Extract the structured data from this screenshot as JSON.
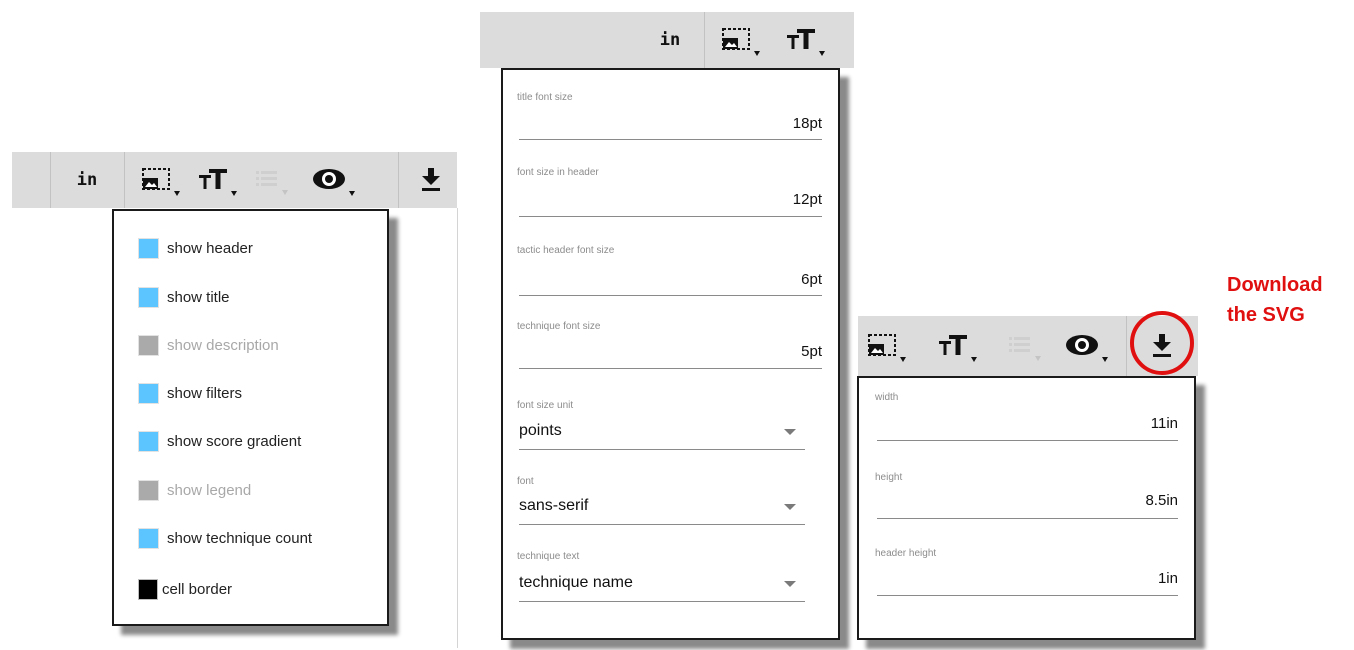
{
  "toolbar": {
    "unit_label": "in",
    "icons": [
      "image-size-icon",
      "font-size-icon",
      "legend-list-icon",
      "visibility-eye-icon",
      "download-icon"
    ]
  },
  "display_menu": {
    "items": [
      {
        "label": "show header",
        "state": "checked"
      },
      {
        "label": "show title",
        "state": "checked"
      },
      {
        "label": "show description",
        "state": "disabled"
      },
      {
        "label": "show filters",
        "state": "checked"
      },
      {
        "label": "show score gradient",
        "state": "checked"
      },
      {
        "label": "show legend",
        "state": "disabled"
      },
      {
        "label": "show technique count",
        "state": "checked"
      },
      {
        "label": "cell border",
        "state": "color-black"
      }
    ]
  },
  "font_menu": {
    "fields": [
      {
        "label": "title font size",
        "value": "18pt"
      },
      {
        "label": "font size in header",
        "value": "12pt"
      },
      {
        "label": "tactic header font size",
        "value": "6pt"
      },
      {
        "label": "technique font size",
        "value": "5pt"
      }
    ],
    "selects": [
      {
        "label": "font size unit",
        "value": "points"
      },
      {
        "label": "font",
        "value": "sans-serif"
      },
      {
        "label": "technique text",
        "value": "technique name"
      }
    ]
  },
  "size_menu": {
    "fields": [
      {
        "label": "width",
        "value": "11in"
      },
      {
        "label": "height",
        "value": "8.5in"
      },
      {
        "label": "header height",
        "value": "1in"
      }
    ]
  },
  "annotation": {
    "line1": "Download",
    "line2": "the SVG",
    "color": "#e01010"
  },
  "colors": {
    "toolbar_bg": "#dcdcdc",
    "checkbox_on": "#5cc4ff",
    "checkbox_disabled": "#aaaaaa"
  }
}
